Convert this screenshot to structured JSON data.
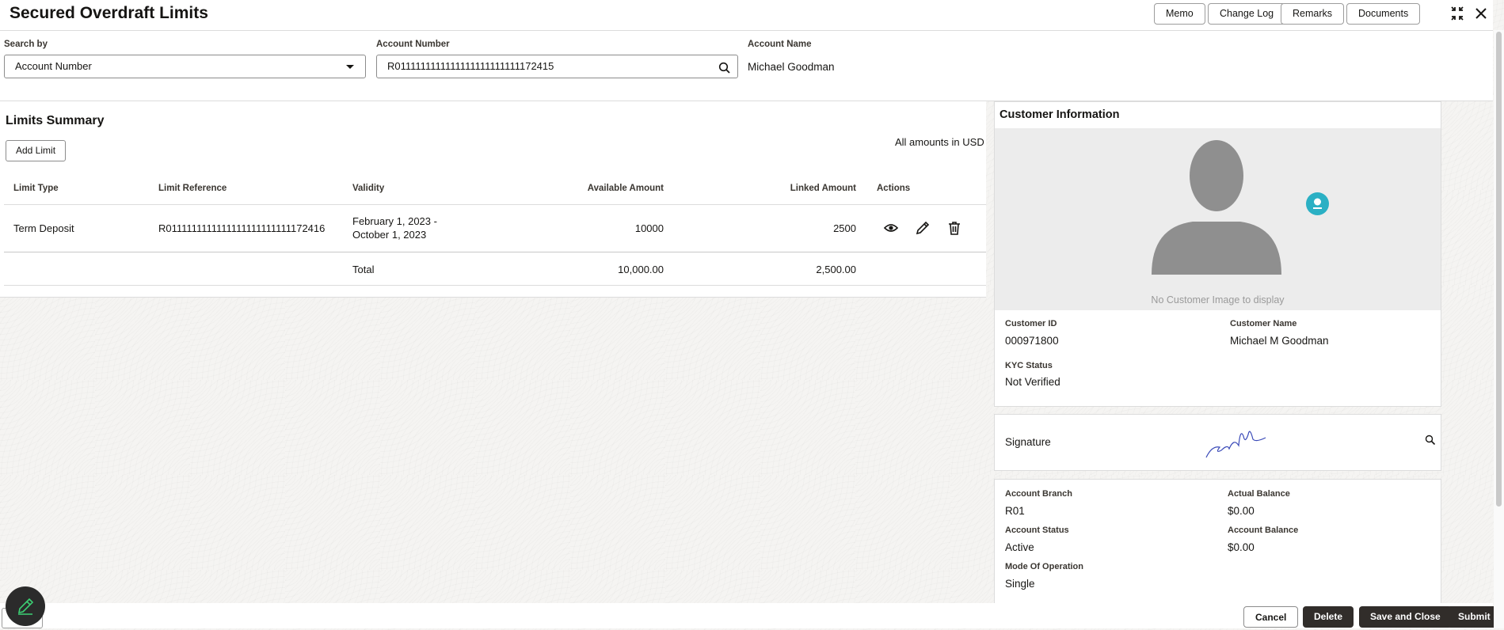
{
  "header": {
    "title": "Secured Overdraft Limits",
    "buttons": {
      "memo": "Memo",
      "change_log": "Change Log",
      "remarks": "Remarks",
      "documents": "Documents"
    }
  },
  "search": {
    "search_by_label": "Search by",
    "search_by_value": "Account Number",
    "account_number_label": "Account Number",
    "account_number_value": "R0111111111111111111111111172415",
    "account_name_label": "Account Name",
    "account_name_value": "Michael Goodman"
  },
  "limits": {
    "title": "Limits Summary",
    "add_limit": "Add Limit",
    "currency_note": "All amounts in USD",
    "columns": [
      "Limit Type",
      "Limit Reference",
      "Validity",
      "Available Amount",
      "Linked Amount",
      "Actions"
    ],
    "rows": [
      {
        "limit_type": "Term Deposit",
        "limit_reference": "R0111111111111111111111111172416",
        "validity_line1": "February 1, 2023 -",
        "validity_line2": "October 1, 2023",
        "available_amount": "10000",
        "linked_amount": "2500"
      }
    ],
    "total": {
      "label": "Total",
      "available": "10,000.00",
      "linked": "2,500.00"
    }
  },
  "customer": {
    "title": "Customer Information",
    "no_image": "No Customer Image to display",
    "customer_id_label": "Customer ID",
    "customer_id": "000971800",
    "customer_name_label": "Customer Name",
    "customer_name": "Michael M Goodman",
    "kyc_label": "KYC Status",
    "kyc_value": "Not Verified"
  },
  "signature": {
    "label": "Signature"
  },
  "account": {
    "branch_label": "Account Branch",
    "branch": "R01",
    "actual_balance_label": "Actual Balance",
    "actual_balance": "$0.00",
    "status_label": "Account Status",
    "status": "Active",
    "account_balance_label": "Account Balance",
    "account_balance": "$0.00",
    "mode_label": "Mode Of Operation",
    "mode": "Single"
  },
  "footer": {
    "cancel": "Cancel",
    "delete": "Delete",
    "save_close": "Save and Close",
    "submit": "Submit"
  },
  "colors": {
    "dark_button": "#312d2a",
    "accent_teal": "#2bb0c4",
    "fab_green": "#3cd174"
  }
}
